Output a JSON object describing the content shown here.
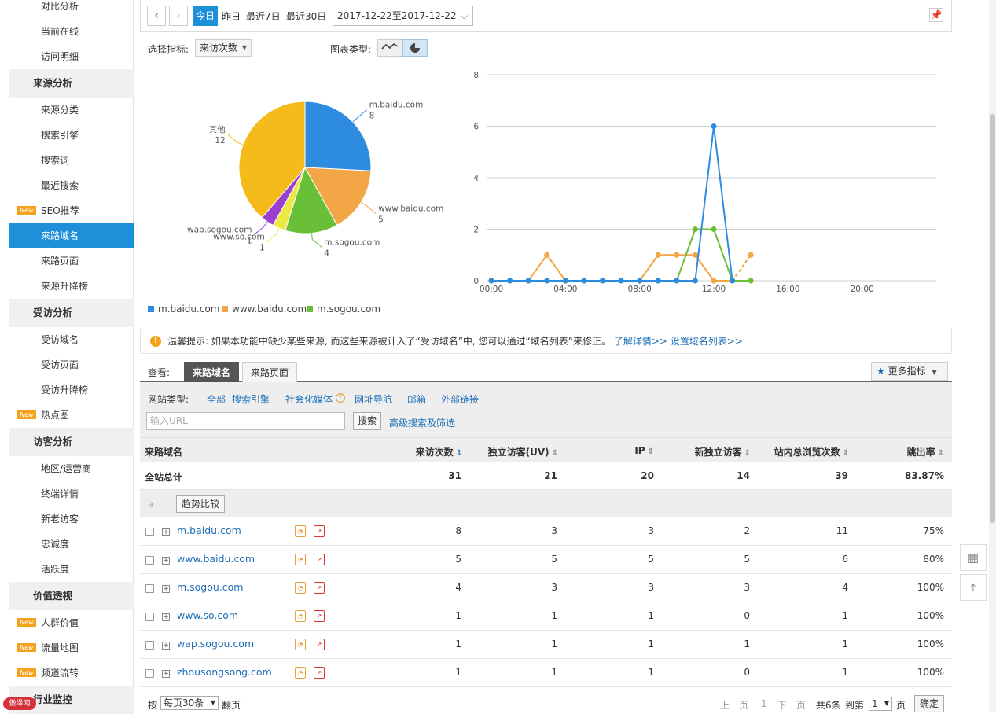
{
  "sidebar": {
    "items": [
      {
        "type": "item",
        "label": "对比分析"
      },
      {
        "type": "item",
        "label": "当前在线"
      },
      {
        "type": "item",
        "label": "访问明细"
      },
      {
        "type": "head",
        "label": "来源分析"
      },
      {
        "type": "item",
        "label": "来源分类"
      },
      {
        "type": "item",
        "label": "搜索引擎"
      },
      {
        "type": "item",
        "label": "搜索词"
      },
      {
        "type": "item",
        "label": "最近搜索"
      },
      {
        "type": "item",
        "label": "SEO推荐",
        "badge": "New"
      },
      {
        "type": "item",
        "label": "来路域名",
        "active": true
      },
      {
        "type": "item",
        "label": "来路页面"
      },
      {
        "type": "item",
        "label": "来源升降榜"
      },
      {
        "type": "head",
        "label": "受访分析"
      },
      {
        "type": "item",
        "label": "受访域名"
      },
      {
        "type": "item",
        "label": "受访页面"
      },
      {
        "type": "item",
        "label": "受访升降榜"
      },
      {
        "type": "item",
        "label": "热点图",
        "badge": "New"
      },
      {
        "type": "head",
        "label": "访客分析"
      },
      {
        "type": "item",
        "label": "地区/运营商"
      },
      {
        "type": "item",
        "label": "终端详情"
      },
      {
        "type": "item",
        "label": "新老访客"
      },
      {
        "type": "item",
        "label": "忠诚度"
      },
      {
        "type": "item",
        "label": "活跃度"
      },
      {
        "type": "head",
        "label": "价值透视"
      },
      {
        "type": "item",
        "label": "人群价值",
        "badge": "New"
      },
      {
        "type": "item",
        "label": "流量地图",
        "badge": "New"
      },
      {
        "type": "item",
        "label": "频道流转",
        "badge": "New"
      },
      {
        "type": "head",
        "label": "行业监控"
      }
    ],
    "logo_text": "傲泽网"
  },
  "toolbar": {
    "prev": "‹",
    "next": "›",
    "today": "今日",
    "yesterday": "昨日",
    "last7": "最近7日",
    "last30": "最近30日",
    "date_range": "2017-12-22至2017-12-22",
    "pin_icon": "pin-icon"
  },
  "controls": {
    "metric_label": "选择指标:",
    "metric_value": "来访次数",
    "chart_type_label": "图表类型:"
  },
  "pie": {
    "slices": [
      {
        "name": "m.baidu.com",
        "value": 8,
        "color": "#2d8ce0"
      },
      {
        "name": "www.baidu.com",
        "value": 5,
        "color": "#f3a646"
      },
      {
        "name": "m.sogou.com",
        "value": 4,
        "color": "#6abf38"
      },
      {
        "name": "www.so.com",
        "value": 1,
        "color": "#ece944"
      },
      {
        "name": "wap.sogou.com",
        "value": 1,
        "color": "#9a3fd1"
      },
      {
        "name": "其他",
        "value": 12,
        "color": "#f4bb1a"
      }
    ]
  },
  "chart_data": {
    "type": "line",
    "x": [
      "00:00",
      "01:00",
      "02:00",
      "03:00",
      "04:00",
      "05:00",
      "06:00",
      "07:00",
      "08:00",
      "09:00",
      "10:00",
      "11:00",
      "12:00",
      "13:00",
      "14:00"
    ],
    "x_ticks": [
      "00:00",
      "04:00",
      "08:00",
      "12:00",
      "16:00",
      "20:00"
    ],
    "ylim": [
      0,
      8
    ],
    "y_ticks": [
      0,
      2,
      4,
      6,
      8
    ],
    "series": [
      {
        "name": "m.baidu.com",
        "color": "#2d8ce0",
        "values": [
          0,
          0,
          0,
          0,
          0,
          0,
          0,
          0,
          0,
          0,
          0,
          0,
          6,
          0,
          null
        ]
      },
      {
        "name": "www.baidu.com",
        "color": "#f3a646",
        "values": [
          0,
          0,
          0,
          1,
          0,
          0,
          0,
          0,
          0,
          1,
          1,
          1,
          0,
          0,
          1
        ]
      },
      {
        "name": "m.sogou.com",
        "color": "#6abf38",
        "values": [
          0,
          0,
          0,
          0,
          0,
          0,
          0,
          0,
          0,
          0,
          0,
          2,
          2,
          0,
          0
        ]
      }
    ],
    "legend": [
      "m.baidu.com",
      "www.baidu.com",
      "m.sogou.com"
    ]
  },
  "tip": {
    "icon": "!",
    "text": "温馨提示: 如果本功能中缺少某些来源, 而这些来源被计入了“受访域名”中, 您可以通过“域名列表”来修正。",
    "link1": "了解详情>>",
    "link2": "设置域名列表>>"
  },
  "view": {
    "label": "查看:",
    "tab_active": "来路域名",
    "tab_other": "来路页面",
    "more": "更多指标"
  },
  "filter": {
    "type_label": "网站类型:",
    "types": [
      "全部",
      "搜索引擎",
      "社会化媒体",
      "网址导航",
      "邮箱",
      "外部链接"
    ],
    "url_placeholder": "输入URL",
    "search_btn": "搜索",
    "advanced": "高级搜索及筛选"
  },
  "table": {
    "columns": [
      "来路域名",
      "来访次数",
      "独立访客(UV)",
      "IP",
      "新独立访客",
      "站内总浏览次数",
      "跳出率"
    ],
    "total": [
      "全站总计",
      "31",
      "21",
      "20",
      "14",
      "39",
      "83.87%"
    ],
    "trend_btn": "趋势比较",
    "rows": [
      [
        "m.baidu.com",
        "8",
        "3",
        "3",
        "2",
        "11",
        "75%"
      ],
      [
        "www.baidu.com",
        "5",
        "5",
        "5",
        "5",
        "6",
        "80%"
      ],
      [
        "m.sogou.com",
        "4",
        "3",
        "3",
        "3",
        "4",
        "100%"
      ],
      [
        "www.so.com",
        "1",
        "1",
        "1",
        "0",
        "1",
        "100%"
      ],
      [
        "wap.sogou.com",
        "1",
        "1",
        "1",
        "1",
        "1",
        "100%"
      ],
      [
        "zhousongsong.com",
        "1",
        "1",
        "1",
        "0",
        "1",
        "100%"
      ]
    ]
  },
  "footer": {
    "by": "按",
    "per_page": "每页30条",
    "flip": "翻页",
    "prev": "上一页",
    "page": "1",
    "next": "下一页",
    "total": "共6条",
    "goto": "到第",
    "goto_val": "1",
    "page_unit": "页",
    "confirm": "确定"
  }
}
